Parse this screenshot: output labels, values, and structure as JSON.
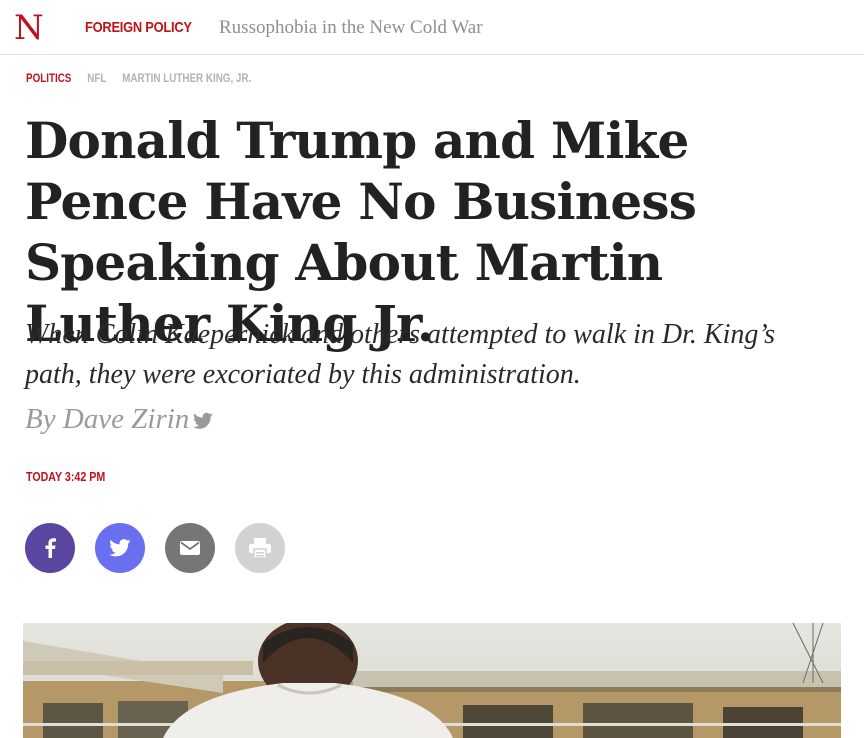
{
  "header": {
    "logo": "N",
    "section": "FOREIGN POLICY",
    "story_link": "Russophobia in the New Cold War"
  },
  "tags": [
    "POLITICS",
    "NFL",
    "MARTIN LUTHER KING, JR."
  ],
  "article": {
    "headline": "Donald Trump and Mike Pence Have No Business Speaking About Martin Luther King Jr.",
    "dek": "When Colin Kaepernick and others attempted to walk in Dr. King’s path, they were excoriated by this administration.",
    "byline_prefix": "By",
    "author": "Dave Zirin",
    "timestamp": "TODAY 3:42 PM"
  },
  "share_buttons": [
    {
      "icon": "facebook-icon",
      "color": "#5a45a0"
    },
    {
      "icon": "twitter-icon",
      "color": "#6a6ff0"
    },
    {
      "icon": "email-icon",
      "color": "#767676"
    },
    {
      "icon": "print-icon",
      "color": "#d2d2d2"
    }
  ],
  "colors": {
    "accent": "#c0121a",
    "headline": "#222222",
    "muted": "#9a9a9a"
  }
}
